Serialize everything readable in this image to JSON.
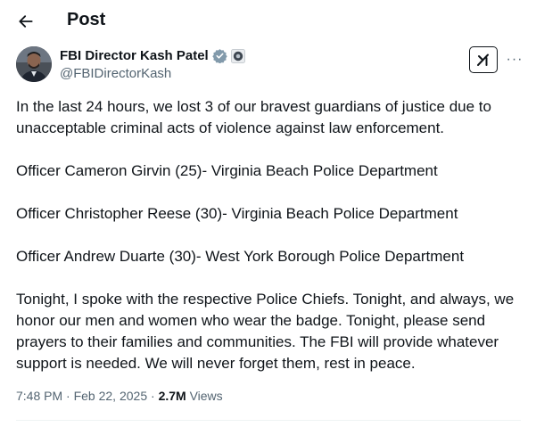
{
  "header": {
    "title": "Post",
    "back_icon": "arrow-left-icon"
  },
  "author": {
    "name": "FBI Director Kash Patel",
    "handle": "@FBIDirectorKash",
    "verified_icon": "verified-badge-icon",
    "affiliate_icon": "government-seal-icon",
    "verified_color": "#829aab"
  },
  "actions": {
    "grok_icon": "grok-icon",
    "more_icon": "more-horizontal-icon",
    "more_label": "···"
  },
  "tweet": {
    "paragraphs": [
      "In the last 24 hours, we lost 3 of our bravest guardians of justice due to unacceptable criminal acts of violence against law enforcement.",
      "Officer Cameron Girvin (25)- Virginia Beach Police Department",
      "Officer Christopher Reese (30)- Virginia Beach Police Department",
      "Officer Andrew Duarte (30)- West York Borough Police Department",
      "Tonight, I spoke with the respective Police Chiefs. Tonight, and always, we honor our men and women who wear the badge. Tonight, please send prayers to their families and communities. The FBI will provide whatever support is needed. We will never forget them, rest in peace."
    ]
  },
  "meta": {
    "time": "7:48 PM",
    "separator": "·",
    "date": "Feb 22, 2025",
    "views_count": "2.7M",
    "views_label": "Views"
  }
}
